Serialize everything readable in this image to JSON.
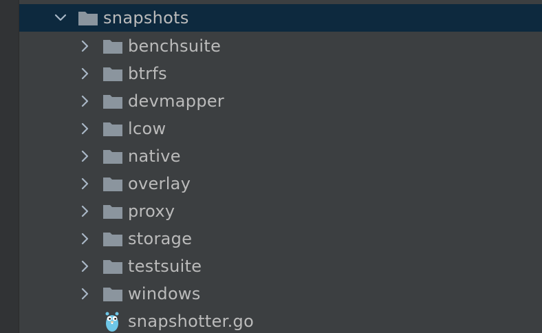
{
  "colors": {
    "background": "#3c3f41",
    "selection": "#0d293e",
    "text": "#bbbbbb",
    "folder": "#8b959e",
    "chevron": "#a9b7c6"
  },
  "tree": {
    "root": {
      "label": "snapshots",
      "expanded": true,
      "icon": "folder-icon"
    },
    "children": [
      {
        "label": "benchsuite",
        "icon": "folder-icon"
      },
      {
        "label": "btrfs",
        "icon": "folder-icon"
      },
      {
        "label": "devmapper",
        "icon": "folder-icon"
      },
      {
        "label": "lcow",
        "icon": "folder-icon"
      },
      {
        "label": "native",
        "icon": "folder-icon"
      },
      {
        "label": "overlay",
        "icon": "folder-icon"
      },
      {
        "label": "proxy",
        "icon": "folder-icon"
      },
      {
        "label": "storage",
        "icon": "folder-icon"
      },
      {
        "label": "testsuite",
        "icon": "folder-icon"
      },
      {
        "label": "windows",
        "icon": "folder-icon"
      }
    ],
    "file": {
      "label": "snapshotter.go",
      "icon": "go-gopher-icon"
    }
  }
}
